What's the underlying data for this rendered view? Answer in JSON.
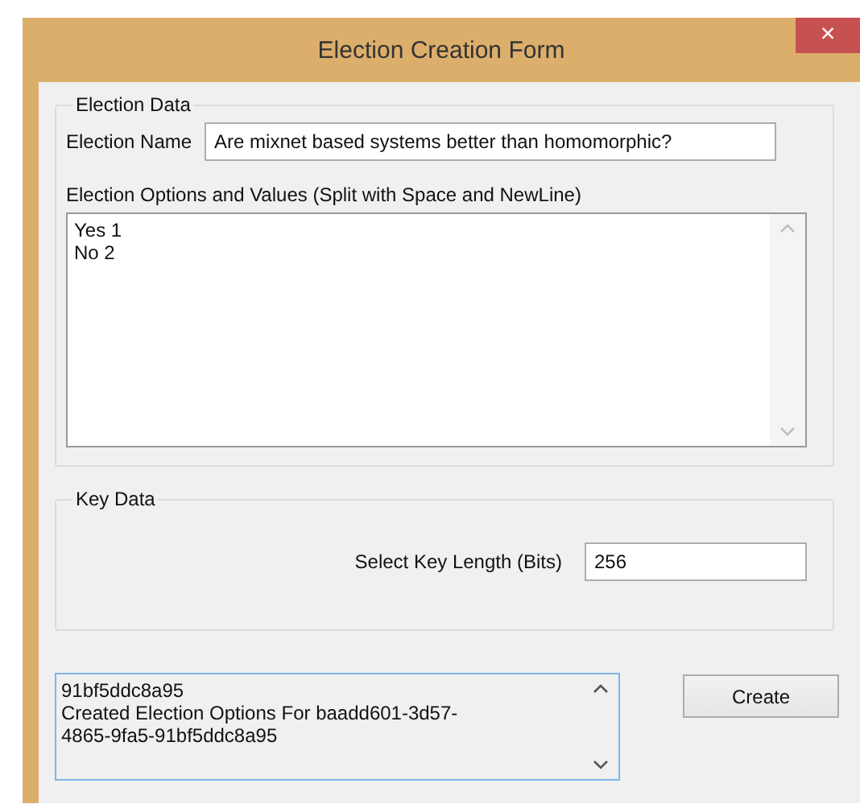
{
  "window": {
    "title": "Election Creation Form",
    "close": "×"
  },
  "election_data": {
    "legend": "Election Data",
    "name_label": "Election Name",
    "name_value": "Are mixnet based systems better than homomorphic?",
    "options_label": "Election Options and Values (Split with Space and NewLine)",
    "options_lines": [
      "Yes 1",
      "No 2"
    ]
  },
  "key_data": {
    "legend": "Key Data",
    "key_length_label": "Select Key Length (Bits)",
    "key_length_value": "256"
  },
  "log": {
    "lines": [
      "91bf5ddc8a95",
      "Created Election Options For baadd601-3d57-",
      "4865-9fa5-91bf5ddc8a95"
    ]
  },
  "buttons": [
    {
      "label": "Create"
    }
  ]
}
